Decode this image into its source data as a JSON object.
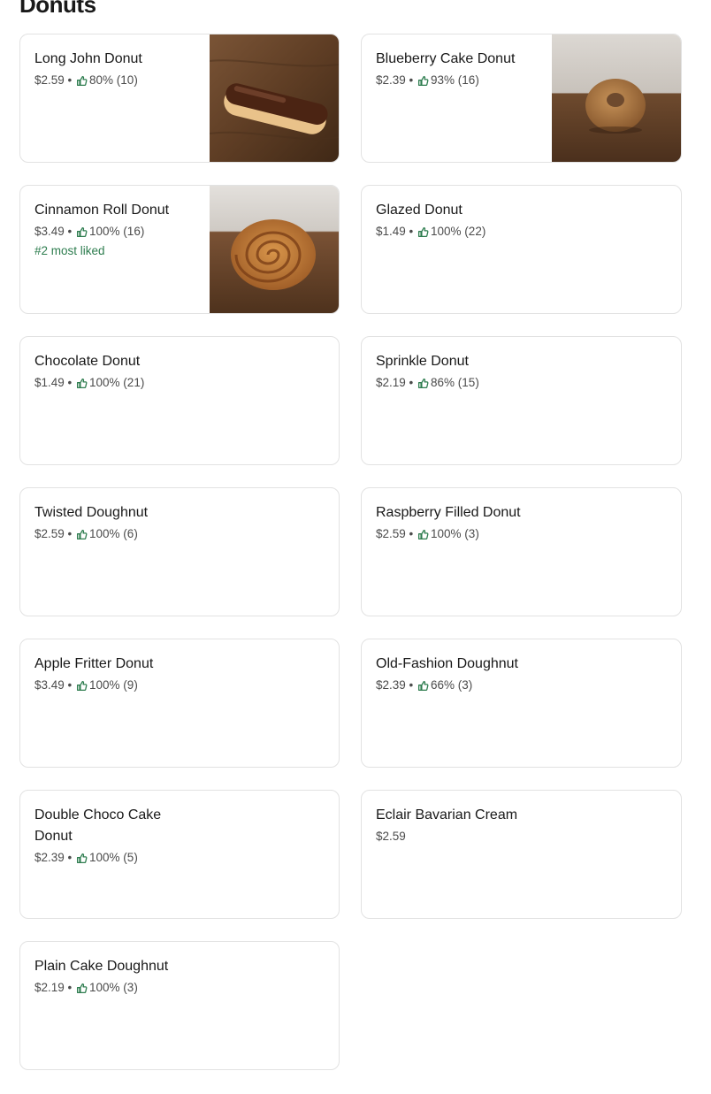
{
  "section": {
    "title": "Donuts"
  },
  "items": [
    {
      "name": "Long John Donut",
      "price": "$2.59",
      "rating": "80% (10)",
      "image": "long-john-donut-photo"
    },
    {
      "name": "Blueberry Cake Donut",
      "price": "$2.39",
      "rating": "93% (16)",
      "image": "blueberry-cake-donut-photo"
    },
    {
      "name": "Cinnamon Roll Donut",
      "price": "$3.49",
      "rating": "100% (16)",
      "badge": "#2 most liked",
      "image": "cinnamon-roll-donut-photo"
    },
    {
      "name": "Glazed Donut",
      "price": "$1.49",
      "rating": "100% (22)"
    },
    {
      "name": "Chocolate Donut",
      "price": "$1.49",
      "rating": "100% (21)"
    },
    {
      "name": "Sprinkle Donut",
      "price": "$2.19",
      "rating": "86% (15)"
    },
    {
      "name": "Twisted Doughnut",
      "price": "$2.59",
      "rating": "100% (6)"
    },
    {
      "name": "Raspberry Filled Donut",
      "price": "$2.59",
      "rating": "100% (3)"
    },
    {
      "name": "Apple Fritter Donut",
      "price": "$3.49",
      "rating": "100% (9)"
    },
    {
      "name": "Old-Fashion Doughnut",
      "price": "$2.39",
      "rating": "66% (3)"
    },
    {
      "name": "Double Choco Cake Donut",
      "price": "$2.39",
      "rating": "100% (5)"
    },
    {
      "name": "Eclair Bavarian Cream",
      "price": "$2.59"
    },
    {
      "name": "Plain Cake Doughnut",
      "price": "$2.19",
      "rating": "100% (3)"
    }
  ],
  "icons": {
    "rating": "thumbs-up-icon"
  },
  "colors": {
    "rating_icon": "#2e7d4f",
    "badge": "#2e7d4f",
    "border": "#e2e2e2"
  }
}
